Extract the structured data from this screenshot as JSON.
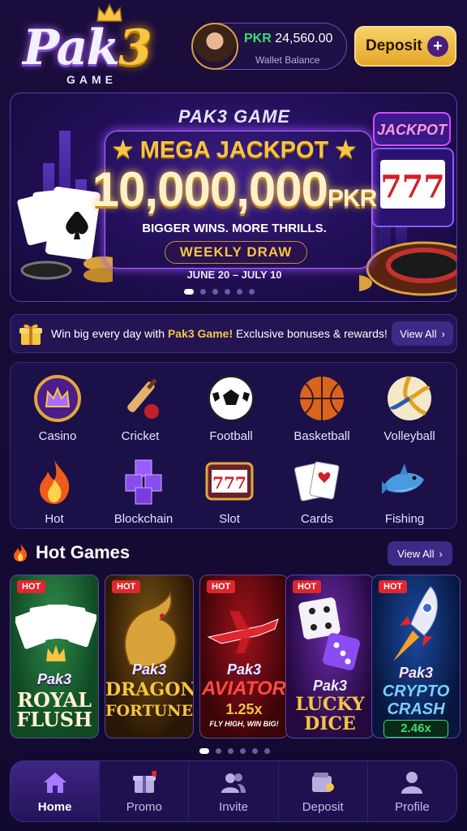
{
  "header": {
    "logo_text": "Pak",
    "logo_number": "3",
    "logo_sub": "GAME",
    "wallet": {
      "currency": "PKR",
      "amount": "24,560.00",
      "label": "Wallet Balance"
    },
    "deposit_label": "Deposit",
    "deposit_icon": "plus-icon"
  },
  "banner": {
    "brand": "PAK3 GAME",
    "headline": "★ MEGA JACKPOT ★",
    "amount": "10,000,000",
    "amount_unit": "PKR",
    "tagline": "BIGGER WINS. MORE THRILLS.",
    "draw_label": "WEEKLY DRAW",
    "dates": "JUNE 20 – JULY 10",
    "slide_count": 6,
    "active_slide": 1,
    "slot_text": "777",
    "slot_sign": "JACKPOT"
  },
  "promo": {
    "icon": "gift-icon",
    "text_before": "Win big every day with",
    "highlight": "Pak3 Game!",
    "text_after": "Exclusive bonuses & rewards!",
    "view_all": "View All",
    "chevron": "›"
  },
  "categories": [
    {
      "label": "Casino",
      "icon": "crown-icon"
    },
    {
      "label": "Cricket",
      "icon": "cricket-bat-icon"
    },
    {
      "label": "Football",
      "icon": "football-icon"
    },
    {
      "label": "Basketball",
      "icon": "basketball-icon"
    },
    {
      "label": "Volleyball",
      "icon": "volleyball-icon"
    },
    {
      "label": "Hot",
      "icon": "flame-icon"
    },
    {
      "label": "Blockchain",
      "icon": "cubes-icon"
    },
    {
      "label": "Slot",
      "icon": "slot-machine-icon"
    },
    {
      "label": "Cards",
      "icon": "playing-cards-icon"
    },
    {
      "label": "Fishing",
      "icon": "shark-icon"
    }
  ],
  "hot_games": {
    "title": "Hot Games",
    "icon": "flame-icon",
    "view_all": "View All",
    "chevron": "›",
    "badge": "HOT",
    "slide_count": 6,
    "active_slide": 1,
    "games": [
      {
        "brand": "Pak3",
        "name1": "ROYAL",
        "name2": "FLUSH",
        "extra": ""
      },
      {
        "brand": "Pak3",
        "name1": "DRAGON",
        "name2": "FORTUNES",
        "extra": ""
      },
      {
        "brand": "Pak3",
        "name1": "AVIATOR",
        "name2": "1.25x",
        "extra": "FLY HIGH, WIN BIG!"
      },
      {
        "brand": "Pak3",
        "name1": "LUCKY",
        "name2": "DICE",
        "extra": ""
      },
      {
        "brand": "Pak3",
        "name1": "CRYPTO",
        "name2": "CRASH",
        "extra": "2.46x"
      }
    ]
  },
  "nav": [
    {
      "label": "Home",
      "icon": "home-icon",
      "active": true
    },
    {
      "label": "Promo",
      "icon": "gift-icon",
      "active": false,
      "notification": true
    },
    {
      "label": "Invite",
      "icon": "users-icon",
      "active": false
    },
    {
      "label": "Deposit",
      "icon": "wallet-icon",
      "active": false
    },
    {
      "label": "Profile",
      "icon": "user-icon",
      "active": false
    }
  ],
  "colors": {
    "accent_gold": "#f6c542",
    "accent_purple": "#7a4fff",
    "hot_red": "#e0262e",
    "currency_green": "#3ddc6c"
  }
}
